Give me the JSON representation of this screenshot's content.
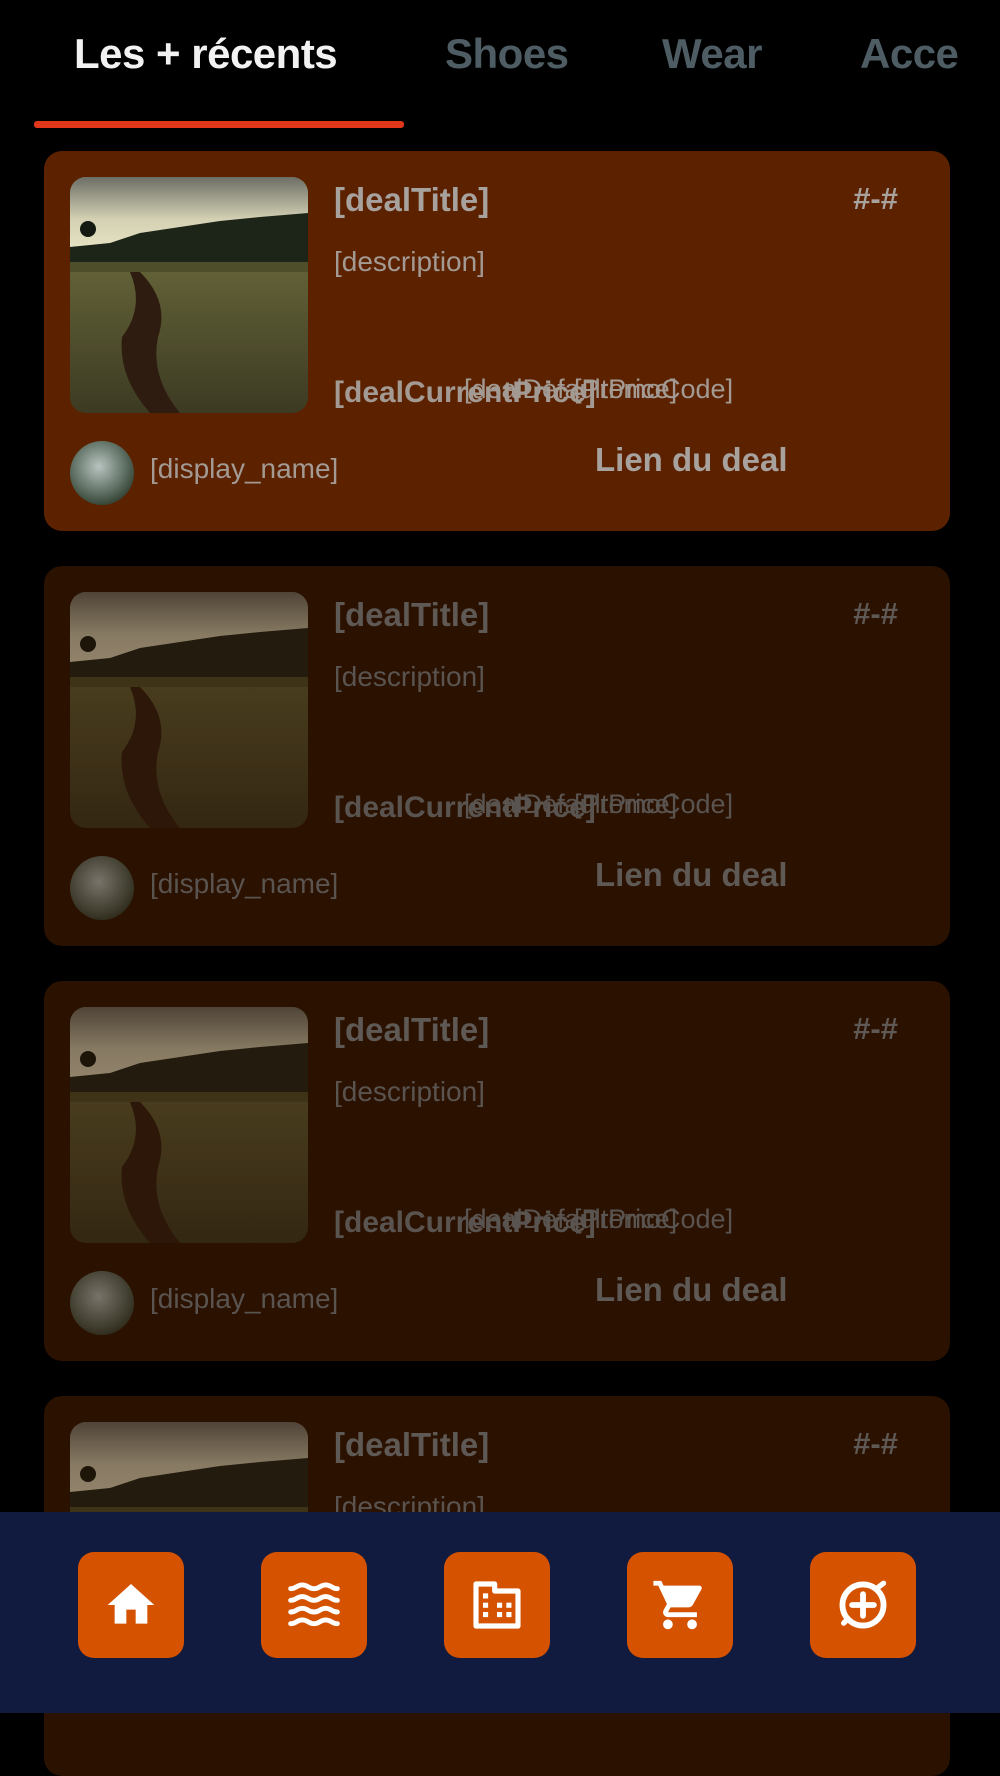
{
  "tabs": [
    {
      "label": "Les + récents",
      "active": true
    },
    {
      "label": "Shoes",
      "active": false
    },
    {
      "label": "Wear",
      "active": false
    },
    {
      "label": "Acce",
      "active": false
    }
  ],
  "deals": [
    {
      "title": "[dealTitle]",
      "code": "#-#",
      "description": "[description]",
      "current_price": "[dealCurrentPrice]",
      "default_price": "[dealDefaultPrice]",
      "promo": "[PromoCode]",
      "display_name": "[display_name]",
      "link_label": "Lien du deal"
    },
    {
      "title": "[dealTitle]",
      "code": "#-#",
      "description": "[description]",
      "current_price": "[dealCurrentPrice]",
      "default_price": "[dealDefaultPrice]",
      "promo": "[PromoCode]",
      "display_name": "[display_name]",
      "link_label": "Lien du deal"
    },
    {
      "title": "[dealTitle]",
      "code": "#-#",
      "description": "[description]",
      "current_price": "[dealCurrentPrice]",
      "default_price": "[dealDefaultPrice]",
      "promo": "[PromoCode]",
      "display_name": "[display_name]",
      "link_label": "Lien du deal"
    },
    {
      "title": "[dealTitle]",
      "code": "#-#",
      "description": "[description]"
    }
  ],
  "nav": [
    {
      "icon": "home-icon"
    },
    {
      "icon": "waves-icon"
    },
    {
      "icon": "building-icon"
    },
    {
      "icon": "cart-icon"
    },
    {
      "icon": "add-circle-icon"
    }
  ],
  "colors": {
    "accent": "#d45200",
    "tab_underline": "#e0371a",
    "nav_background": "#101b3f",
    "card_active": "#5c2200",
    "card_dim": "#2b1100"
  }
}
